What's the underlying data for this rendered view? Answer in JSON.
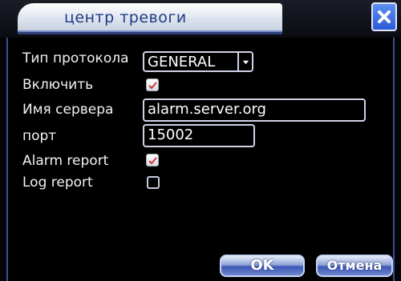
{
  "window": {
    "title": "центр тревоги",
    "close_icon": "close-icon"
  },
  "form": {
    "protocol_type": {
      "label": "Тип протокола",
      "value": "GENERAL"
    },
    "enable": {
      "label": "Включить",
      "checked": true
    },
    "server_name": {
      "label": "Имя сервера",
      "value": "alarm.server.org"
    },
    "port": {
      "label": "порт",
      "value": "15002"
    },
    "alarm_report": {
      "label": "Alarm report",
      "checked": true
    },
    "log_report": {
      "label": "Log report",
      "checked": false
    }
  },
  "buttons": {
    "ok_label": "OK",
    "cancel_label": "Отмена"
  },
  "colors": {
    "accent": "#2f3e78",
    "button": "#3e58b6",
    "title_text": "#203a86"
  }
}
